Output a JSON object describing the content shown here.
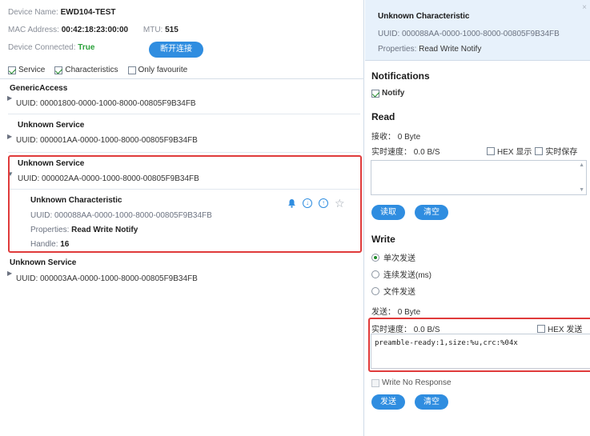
{
  "device": {
    "name_label": "Device Name:",
    "name_value": "EWD104-TEST",
    "mac_label": "MAC Address:",
    "mac_value": "00:42:18:23:00:00",
    "mtu_label": "MTU:",
    "mtu_value": "515",
    "connected_label": "Device Connected:",
    "connected_value": "True",
    "disconnect_label": "断开连接"
  },
  "filters": [
    {
      "label": "Service",
      "checked": true
    },
    {
      "label": "Characteristics",
      "checked": true
    },
    {
      "label": "Only favourite",
      "checked": false
    }
  ],
  "services": [
    {
      "name": "GenericAccess",
      "uuid": "UUID: 00001800-0000-1000-8000-00805F9B34FB"
    },
    {
      "name": "Unknown Service",
      "uuid": "UUID: 000001AA-0000-1000-8000-00805F9B34FB"
    },
    {
      "name": "Unknown Service",
      "uuid": "UUID: 000002AA-0000-1000-8000-00805F9B34FB"
    },
    {
      "name": "Unknown Service",
      "uuid": "UUID: 000003AA-0000-1000-8000-00805F9B34FB"
    }
  ],
  "characteristic": {
    "name": "Unknown Characteristic",
    "uuid": "UUID: 000088AA-0000-1000-8000-00805F9B34FB",
    "properties_label": "Properties:",
    "properties_value": "Read Write Notify",
    "handle_label": "Handle:",
    "handle_value": "16"
  },
  "detail": {
    "title": "Unknown Characteristic",
    "uuid": "UUID: 000088AA-0000-1000-8000-00805F9B34FB",
    "properties_label": "Properties:",
    "properties_value": "Read Write Notify",
    "close": "×"
  },
  "notifications": {
    "title": "Notifications",
    "notify_label": "Notify"
  },
  "read": {
    "title": "Read",
    "received": "接收： 0 Byte",
    "speed": "实时速度： 0.0 B/S",
    "hex_display": "HEX 显示",
    "realtime_save": "实时保存",
    "read_btn": "读取",
    "clear_btn": "清空"
  },
  "write": {
    "title": "Write",
    "modes": [
      {
        "label": "单次发送",
        "selected": true
      },
      {
        "label": "连续发送(ms)",
        "selected": false
      },
      {
        "label": "文件发送",
        "selected": false
      }
    ],
    "sent": "发送： 0 Byte",
    "speed": "实时速度： 0.0 B/S",
    "hex_send": "HEX 发送",
    "input_value": "preamble-ready:1,size:%u,crc:%04x",
    "no_response": "Write No Response",
    "send_btn": "发送",
    "clear_btn": "清空"
  }
}
